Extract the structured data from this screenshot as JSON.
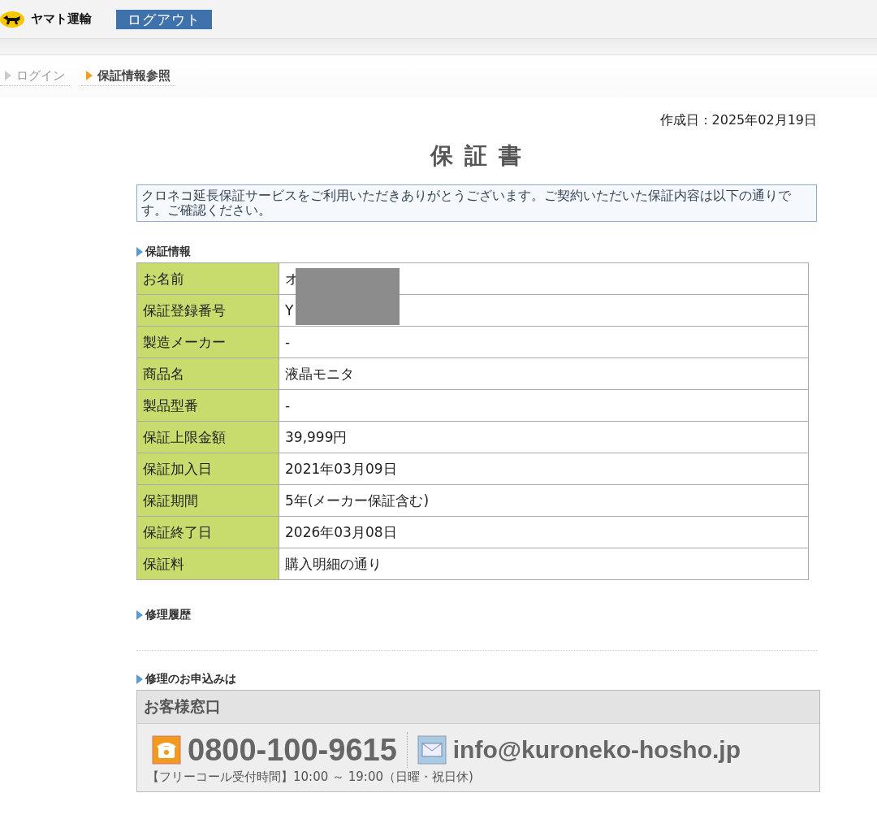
{
  "header": {
    "brand": "ヤマト運輸",
    "logout_button": "ログアウト"
  },
  "breadcrumb": [
    {
      "label": "ログイン",
      "selected": false
    },
    {
      "label": "保証情報参照",
      "selected": true
    }
  ],
  "created_date": "作成日：2025年02月19日",
  "title": "保 証 書",
  "notice": "クロネコ延長保証サービスをご利用いただきありがとうございます。ご契約いただいた保証内容は以下の通りです。ご確認ください。",
  "warranty_section": {
    "heading": "保証情報",
    "rows": [
      {
        "label": "お名前",
        "value": "オ"
      },
      {
        "label": "保証登録番号",
        "value": "Y"
      },
      {
        "label": "製造メーカー",
        "value": "-"
      },
      {
        "label": "商品名",
        "value": "液晶モニタ"
      },
      {
        "label": "製品型番",
        "value": "-"
      },
      {
        "label": "保証上限金額",
        "value": "39,999円"
      },
      {
        "label": "保証加入日",
        "value": "2021年03月09日"
      },
      {
        "label": "保証期間",
        "value": "5年(メーカー保証含む)"
      },
      {
        "label": "保証終了日",
        "value": "2026年03月08日"
      },
      {
        "label": "保証料",
        "value": "購入明細の通り"
      }
    ]
  },
  "repair_history": {
    "heading": "修理履歴"
  },
  "repair_contact": {
    "heading": "修理のお申込みは",
    "box_title": "お客様窓口",
    "phone": "0800-100-9615",
    "email": "info@kuroneko-hosho.jp",
    "hours": "【フリーコール受付時間】10:00 ～ 19:00（日曜・祝日休)"
  }
}
